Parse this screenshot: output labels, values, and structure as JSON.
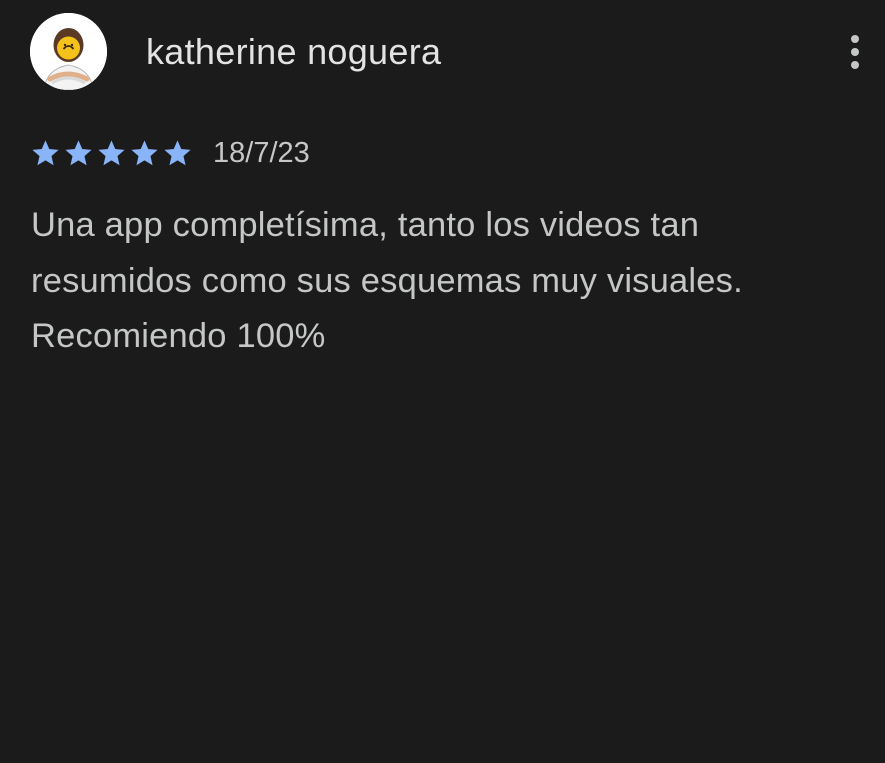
{
  "review": {
    "author": "katherine noguera",
    "rating": 5,
    "rating_max": 5,
    "date": "18/7/23",
    "text": "Una app completísima, tanto los videos tan resumidos como sus esquemas muy visuales. Recomiendo 100%",
    "star_color": "#8ab4f8"
  },
  "icons": {
    "more": "more-vert-icon",
    "star": "star-icon",
    "avatar": "user-avatar-image"
  },
  "colors": {
    "background": "#1b1b1c",
    "name_text": "#e3e3e3",
    "secondary_text": "#c4c7c5"
  }
}
